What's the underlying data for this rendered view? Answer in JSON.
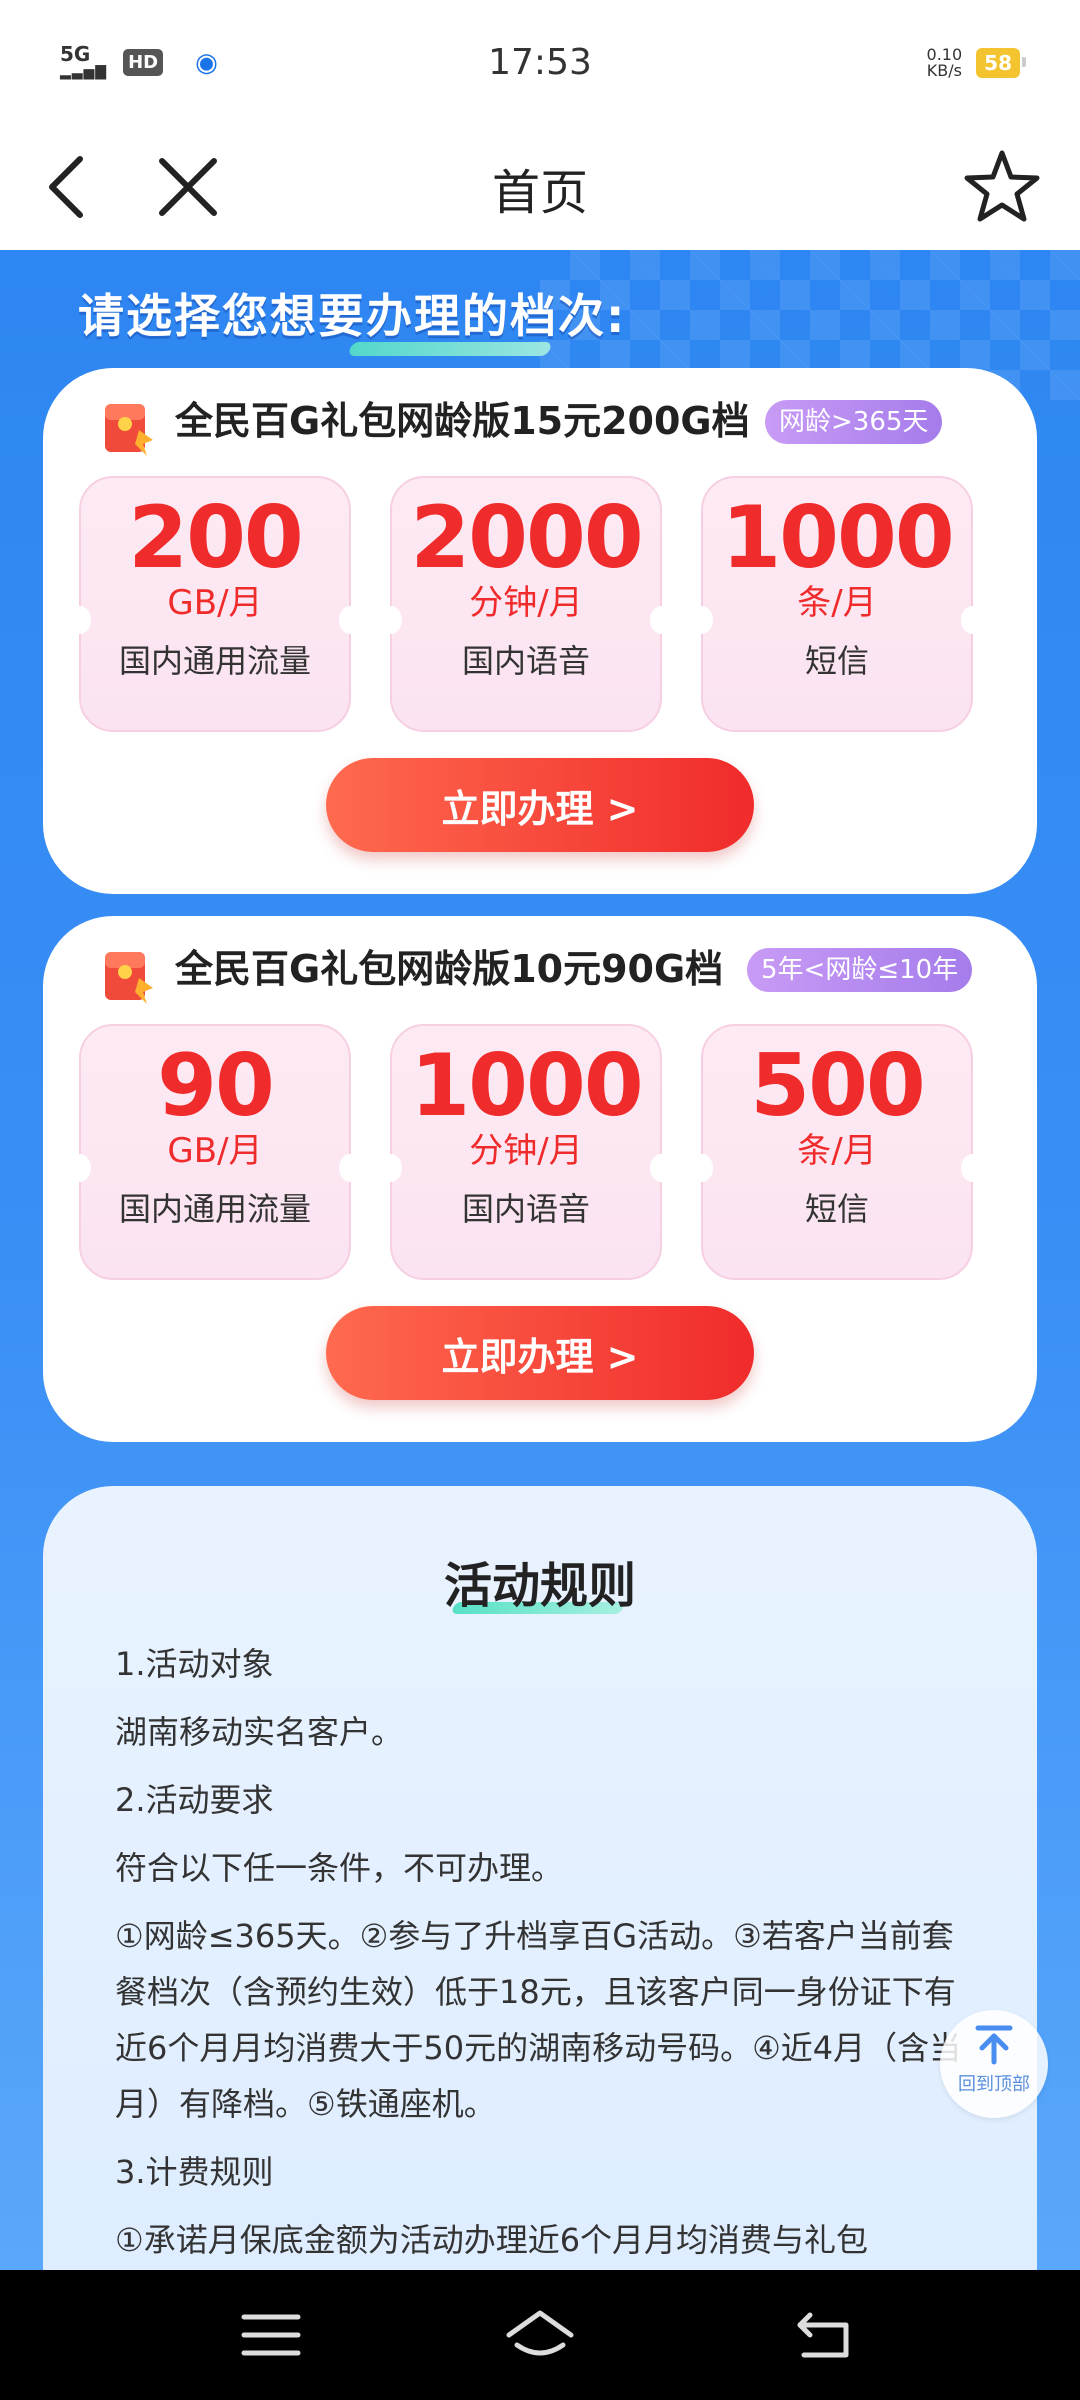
{
  "status_bar": {
    "signal": "5G",
    "hd": "HD",
    "time": "17:53",
    "net_speed_value": "0.10",
    "net_speed_unit": "KB/s",
    "battery": "58"
  },
  "nav": {
    "title": "首页"
  },
  "headline": "请选择您想要办理的档次:",
  "plans": [
    {
      "title": "全民百G礼包网龄版15元200G档",
      "tag": "网龄>365天",
      "benefits": [
        {
          "value": "200",
          "unit": "GB/月",
          "label": "国内通用流量"
        },
        {
          "value": "2000",
          "unit": "分钟/月",
          "label": "国内语音"
        },
        {
          "value": "1000",
          "unit": "条/月",
          "label": "短信"
        }
      ],
      "cta": "立即办理 >"
    },
    {
      "title": "全民百G礼包网龄版10元90G档",
      "tag": "5年<网龄≤10年",
      "benefits": [
        {
          "value": "90",
          "unit": "GB/月",
          "label": "国内通用流量"
        },
        {
          "value": "1000",
          "unit": "分钟/月",
          "label": "国内语音"
        },
        {
          "value": "500",
          "unit": "条/月",
          "label": "短信"
        }
      ],
      "cta": "立即办理 >"
    }
  ],
  "rules": {
    "title": "活动规则",
    "paragraphs": [
      "1.活动对象",
      "湖南移动实名客户。",
      "2.活动要求",
      "符合以下任一条件，不可办理。",
      "①网龄≤365天。②参与了升档享百G活动。③若客户当前套餐档次（含预约生效）低于18元，且该客户同一身份证下有近6个月月均消费大于50元的湖南移动号码。④近4月（含当月）有降档。⑤铁通座机。",
      "3.计费规则",
      "①承诺月保底金额为活动办理近6个月月均消费与礼包"
    ]
  },
  "back_to_top": "回到顶部",
  "colors": {
    "brand_blue": "#2e86f2",
    "accent_red": "#f02b2b",
    "tag_purple": "#a57ceb"
  }
}
